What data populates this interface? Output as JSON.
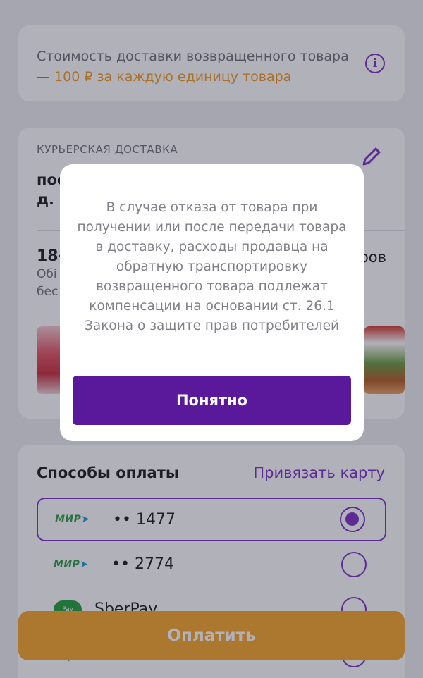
{
  "delivery_info": {
    "text": "Стоимость доставки возвращенного товара — ",
    "accent": "100 ₽ за каждую единицу товара",
    "icon": "info-icon"
  },
  "courier": {
    "label": "КУРЬЕРСКАЯ ДОСТАВКА",
    "address": "пос\nд. 3",
    "slot_date": "18-",
    "slot_sub": "Обі\nбес",
    "slot_count": "ров",
    "edit_icon": "pencil-icon"
  },
  "payment": {
    "title": "Способы оплаты",
    "link": "Привязать карту",
    "methods": [
      {
        "brand": "МИР",
        "number": "•• 1477",
        "selected": true
      },
      {
        "brand": "МИР",
        "number": "•• 2774",
        "selected": false
      },
      {
        "brand": "Pay",
        "number": "SberPay",
        "selected": false
      },
      {
        "brand": "",
        "number": "",
        "selected": false
      }
    ]
  },
  "pay_button": "Оплатить",
  "dialog": {
    "text": "В случае отказа от товара при получении или после передачи товара в доставку, расходы продавца на обратную транспортировку возвращенного товара подлежат компенсации на основании ст. 26.1 Закона о защите прав потребителей",
    "button": "Понятно"
  },
  "colors": {
    "accent_purple": "#7b2fc5",
    "dialog_button": "#5a189a",
    "pay_button": "#f7a428",
    "highlight_orange": "#f29a1f"
  }
}
